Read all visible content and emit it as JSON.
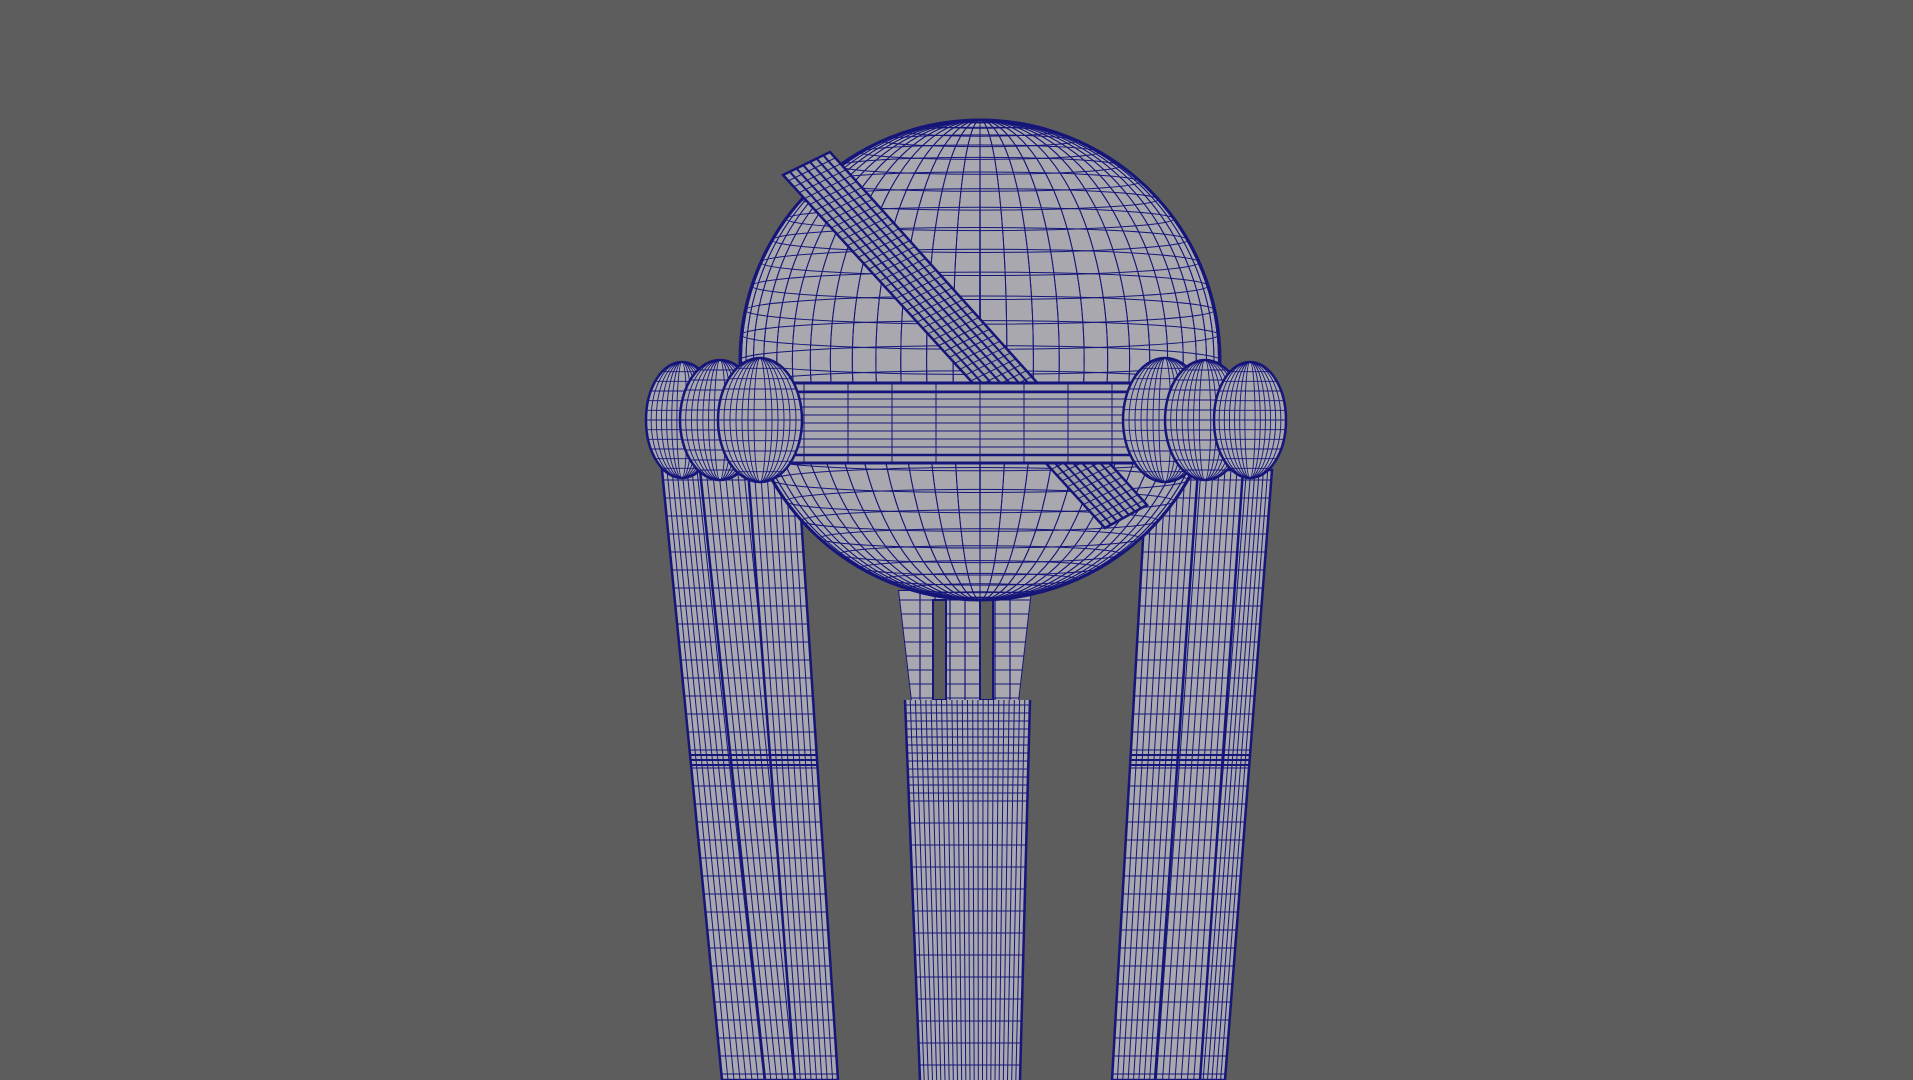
{
  "viewport": {
    "background_color": "#5d5d5d",
    "shading_mode": "wireframe-on-shaded",
    "wire_color": "#16167a",
    "surface_color": "#a8a8ae",
    "surface_dark": "#8f8f96",
    "model": "trophy",
    "parts": [
      "sphere",
      "diagonal-band",
      "crossbar",
      "left-stumps",
      "right-stumps",
      "center-stem"
    ]
  }
}
